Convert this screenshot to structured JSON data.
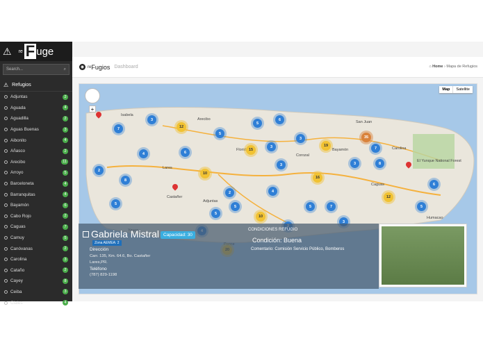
{
  "brand": {
    "re": "re",
    "big": "F",
    "rest": "uge"
  },
  "search": {
    "placeholder": "Search..."
  },
  "sidebar": {
    "section": "Refugios",
    "items": [
      {
        "label": "Adjuntas",
        "count": "2"
      },
      {
        "label": "Aguada",
        "count": "4"
      },
      {
        "label": "Aguadilla",
        "count": "2"
      },
      {
        "label": "Aguas Buenas",
        "count": "3"
      },
      {
        "label": "Aibonito",
        "count": "4"
      },
      {
        "label": "Añasco",
        "count": "2"
      },
      {
        "label": "Arecibo",
        "count": "11"
      },
      {
        "label": "Arroyo",
        "count": "5"
      },
      {
        "label": "Barceloneta",
        "count": "4"
      },
      {
        "label": "Barranquitas",
        "count": "4"
      },
      {
        "label": "Bayamón",
        "count": "6"
      },
      {
        "label": "Cabo Rojo",
        "count": "2"
      },
      {
        "label": "Caguas",
        "count": "7"
      },
      {
        "label": "Camuy",
        "count": "5"
      },
      {
        "label": "Canóvanas",
        "count": "2"
      },
      {
        "label": "Carolina",
        "count": "3"
      },
      {
        "label": "Cataño",
        "count": "2"
      },
      {
        "label": "Cayey",
        "count": "8"
      },
      {
        "label": "Ceiba",
        "count": "3"
      },
      {
        "label": "Ciales",
        "count": "4"
      }
    ]
  },
  "topbar": {
    "t1": "re",
    "t2": "Fugios",
    "t3": "Dashboard"
  },
  "crumb": {
    "home": "Home",
    "sep": "›",
    "page": "Mapa de Refugios"
  },
  "map": {
    "map_btn": "Map",
    "sat_btn": "Satellite"
  },
  "panel": {
    "name": "Gabriela Mistral",
    "cap": "Capacidad: 30",
    "zona": "Zona AEMEA: 2",
    "dir_label": "Dirección",
    "dir_line1": "Carr. 135, Km. 64.6, Bo. Castañer",
    "dir_line2": "Lares,PR.",
    "tel_label": "Teléfono",
    "tel": "(787) 829-1198",
    "cond_label": "CONDICIONES REFUGIO",
    "cond_value": "Condición: Buena",
    "comm": "Comentario: Comisión Servicio Público, Bomberos"
  },
  "map_labels": [
    "Isabela",
    "Arecibo",
    "San Juan",
    "Carolina",
    "Bayamón",
    "Caguas",
    "Lares",
    "Castañer",
    "Adjuntas",
    "Ponce",
    "Yauco",
    "Florida",
    "Corozal",
    "Humacao",
    "El Yunque National Forest"
  ],
  "clusters": [
    "7",
    "3",
    "12",
    "5",
    "5",
    "6",
    "3",
    "3",
    "35",
    "19",
    "7",
    "2",
    "15",
    "6",
    "4",
    "3",
    "8",
    "10",
    "16",
    "3",
    "8",
    "2",
    "12",
    "5",
    "6",
    "7",
    "5",
    "5",
    "10",
    "3",
    "4",
    "20",
    "5",
    "4",
    "2",
    "5"
  ]
}
